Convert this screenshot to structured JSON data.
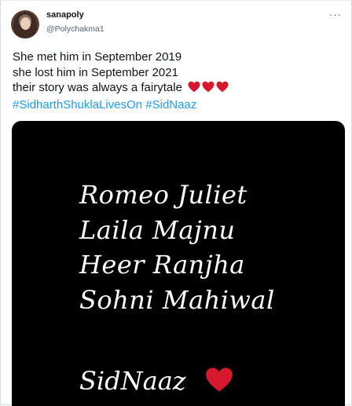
{
  "user": {
    "display_name": "sanapoly",
    "handle": "@Polychakma1"
  },
  "tweet": {
    "lines": [
      "She met him in September 2019",
      "she lost him in September 2021",
      "their story was always a fairytale"
    ],
    "hearts_count": 3,
    "heart_color": "#d7192f",
    "hashtags": [
      "#SidharthShuklaLivesOn",
      "#SidNaaz"
    ]
  },
  "image": {
    "background": "#000000",
    "lines": [
      "Romeo Juliet",
      "Laila Majnu",
      "Heer Ranjha",
      "Sohni Mahiwal"
    ],
    "signoff": "SidNaaz"
  }
}
